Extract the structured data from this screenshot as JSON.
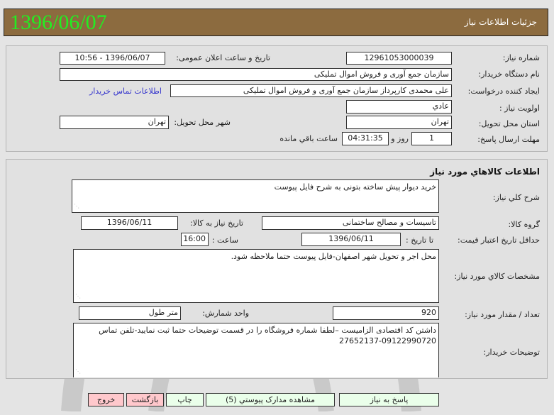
{
  "header": {
    "date": "1396/06/07",
    "title": "جزئیات اطلاعات نیاز"
  },
  "general": {
    "need_number_label": "شماره نیاز:",
    "need_number": "12961053000039",
    "announce_label": "تاریخ و ساعت اعلان عمومی:",
    "announce_value": "1396/06/07 - 10:56",
    "buyer_org_label": "نام دستگاه خریدار:",
    "buyer_org": "سازمان جمع آوری و فروش اموال تملیکی",
    "creator_label": "ایجاد کننده درخواست:",
    "creator": "علی محمدی کارپرداز سازمان جمع آوری و فروش اموال تملیکی",
    "contact_link": "اطلاعات تماس خریدار",
    "priority_label": "اولویت نیاز :",
    "priority": "عادي",
    "province_label": "استان محل تحویل:",
    "province": "تهران",
    "city_label": "شهر محل تحویل:",
    "city": "تهران",
    "deadline_label": "مهلت ارسال پاسخ:",
    "deadline_days": "1",
    "days_and": "روز و",
    "deadline_time": "04:31:35",
    "remaining": "ساعت باقي مانده"
  },
  "goods": {
    "section_title": "اطلاعات کالاهاي مورد نياز",
    "summary_label": "شرح کلي نياز:",
    "summary": "خرید دیوار پیش ساخته بتونی به شرح فایل پیوست",
    "group_label": "گروه کالا:",
    "group": "تاسیسات و مصالح ساختمانی",
    "need_date_label": "تاریخ نیاز به کالا:",
    "need_date": "1396/06/11",
    "price_validity_label": "حداقل تاریخ اعتبار قیمت:",
    "to_date_label": "تا تاریخ :",
    "to_date": "1396/06/11",
    "time_label": "ساعت :",
    "time": "16:00",
    "specs_label": "مشخصات کالاي مورد نياز:",
    "specs": "محل اجر و تحویل شهر اصفهان-فایل پیوست حتما ملاحظه شود.",
    "quantity_label": "تعداد / مقدار مورد نیاز:",
    "quantity": "920",
    "unit_label": "واحد شمارش:",
    "unit": "متر طول",
    "buyer_notes_label": "توضیحات خریدار:",
    "buyer_notes": "داشتن کد اقتصادی الزامیست –لطفا شماره فروشگاه را در قسمت توضیحات حتما ثبت نمایید-تلفن تماس 09122990720-27652137"
  },
  "buttons": {
    "reply": "پاسخ به نیاز",
    "attachments": "مشاهده مدارک پیوستي (5)",
    "print": "چاپ",
    "back": "بازگشت",
    "exit": "خروج"
  }
}
